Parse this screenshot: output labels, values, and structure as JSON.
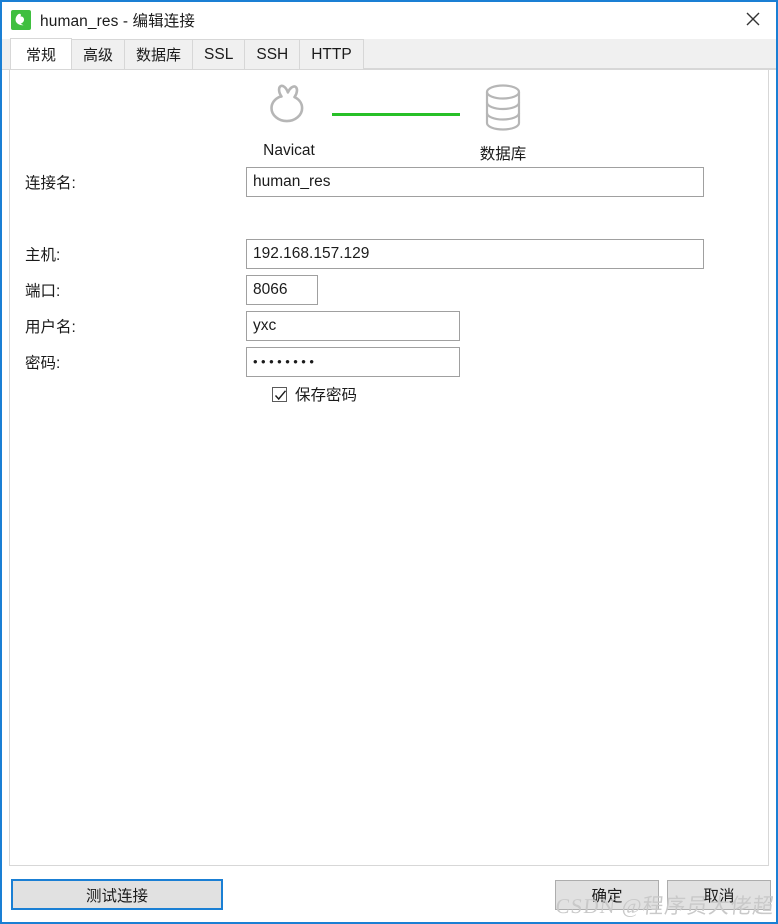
{
  "window": {
    "title": "human_res - 编辑连接",
    "app_icon": "navicat-logo-icon",
    "close_label": "✕",
    "border_color": "#1a7fd4"
  },
  "tabs": [
    {
      "label": "常规",
      "active": true
    },
    {
      "label": "高级",
      "active": false
    },
    {
      "label": "数据库",
      "active": false
    },
    {
      "label": "SSL",
      "active": false
    },
    {
      "label": "SSH",
      "active": false
    },
    {
      "label": "HTTP",
      "active": false
    }
  ],
  "graphic": {
    "left_node_label": "Navicat",
    "right_node_label": "数据库",
    "link_color": "#28c028"
  },
  "form": {
    "connection_name": {
      "label": "连接名:",
      "value": "human_res"
    },
    "host": {
      "label": "主机:",
      "value": "192.168.157.129"
    },
    "port": {
      "label": "端口:",
      "value": "8066"
    },
    "username": {
      "label": "用户名:",
      "value": "yxc"
    },
    "password": {
      "label": "密码:",
      "value": "••••••••"
    },
    "save_password": {
      "label": "保存密码",
      "checked": true
    }
  },
  "footer": {
    "test_connection": "测试连接",
    "ok": "确定",
    "cancel": "取消"
  },
  "watermark": {
    "text": "CSDN @程序员大佬超"
  }
}
